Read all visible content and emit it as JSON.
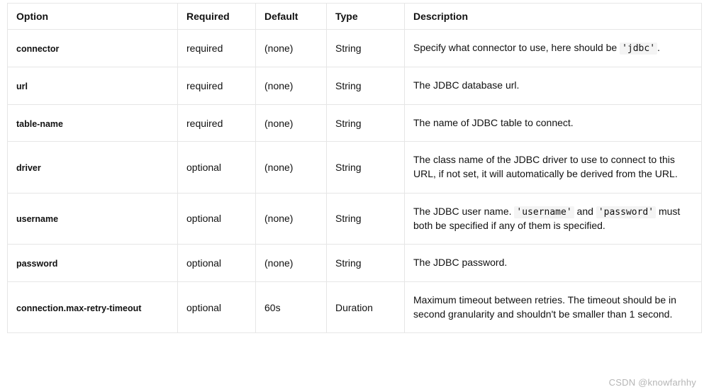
{
  "table": {
    "headers": {
      "option": "Option",
      "required": "Required",
      "default": "Default",
      "type": "Type",
      "description": "Description"
    },
    "rows": [
      {
        "option": "connector",
        "required": "required",
        "default": "(none)",
        "type": "String",
        "description": {
          "segments": [
            {
              "text": "Specify what connector to use, here should be "
            },
            {
              "code": "'jdbc'"
            },
            {
              "text": "."
            }
          ]
        }
      },
      {
        "option": "url",
        "required": "required",
        "default": "(none)",
        "type": "String",
        "description": {
          "segments": [
            {
              "text": "The JDBC database url."
            }
          ]
        }
      },
      {
        "option": "table-name",
        "required": "required",
        "default": "(none)",
        "type": "String",
        "description": {
          "segments": [
            {
              "text": "The name of JDBC table to connect."
            }
          ]
        }
      },
      {
        "option": "driver",
        "required": "optional",
        "default": "(none)",
        "type": "String",
        "description": {
          "segments": [
            {
              "text": "The class name of the JDBC driver to use to connect to this URL, if not set, it will automatically be derived from the URL."
            }
          ]
        }
      },
      {
        "option": "username",
        "required": "optional",
        "default": "(none)",
        "type": "String",
        "description": {
          "segments": [
            {
              "text": "The JDBC user name. "
            },
            {
              "code": "'username'"
            },
            {
              "text": " and "
            },
            {
              "code": "'password'"
            },
            {
              "text": " must both be specified if any of them is specified."
            }
          ]
        }
      },
      {
        "option": "password",
        "required": "optional",
        "default": "(none)",
        "type": "String",
        "description": {
          "segments": [
            {
              "text": "The JDBC password."
            }
          ]
        }
      },
      {
        "option": "connection.max-retry-timeout",
        "required": "optional",
        "default": "60s",
        "type": "Duration",
        "description": {
          "segments": [
            {
              "text": "Maximum timeout between retries. The timeout should be in second granularity and shouldn't be smaller than 1 second."
            }
          ]
        }
      }
    ]
  },
  "watermark": "CSDN @knowfarhhy"
}
